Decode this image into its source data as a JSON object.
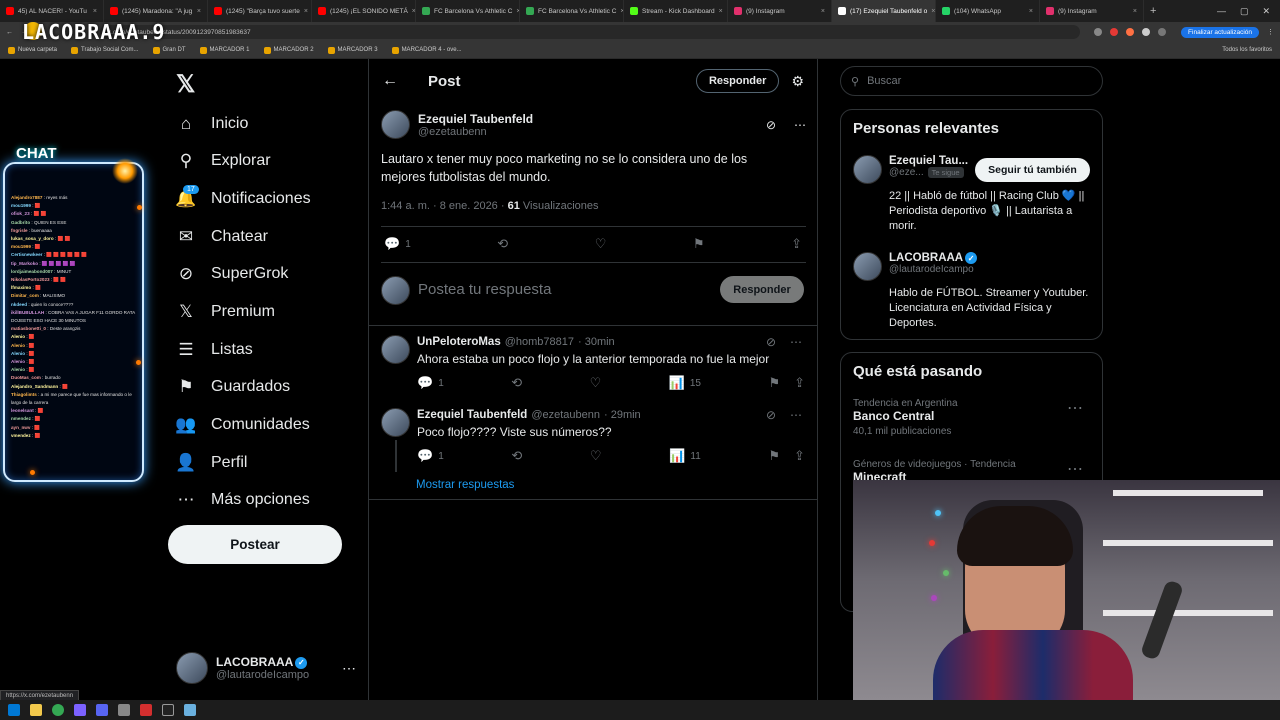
{
  "browser": {
    "tabs": [
      {
        "label": "45) AL NACER! - YouTu",
        "color": "#ff0000"
      },
      {
        "label": "(1245) Maradona: \"A jug",
        "color": "#ff0000"
      },
      {
        "label": "(1245) \"Barça tuvo suerte",
        "color": "#ff0000"
      },
      {
        "label": "(1245) ¡EL SONIDO METÁ",
        "color": "#ff0000"
      },
      {
        "label": "FC Barcelona Vs Athletic C",
        "color": "#34a853"
      },
      {
        "label": "FC Barcelona Vs Athletic C",
        "color": "#34a853"
      },
      {
        "label": "Stream - Kick Dashboard",
        "color": "#53fc18"
      },
      {
        "label": "(9) Instagram",
        "color": "#e1306c"
      },
      {
        "label": "(17) Ezequiel Taubenfeld o",
        "color": "#ffffff"
      },
      {
        "label": "(104) WhatsApp",
        "color": "#25d366"
      },
      {
        "label": "(9) Instagram",
        "color": "#e1306c"
      }
    ],
    "active_tab_index": 8,
    "new_tab": "+",
    "url": "x.com/ezetaubenn/status/2009123970851983637",
    "update_label": "Finalizar actualización",
    "bookmarks": [
      "Nueva carpeta",
      "Trabajo Social Com...",
      "Gran DT",
      "MARCADOR 1",
      "MARCADOR 2",
      "MARCADOR 3",
      "MARCADOR 4 - ove..."
    ],
    "all_bookmarks": "Todos los favoritos",
    "status_url": "https://x.com/ezetaubenn"
  },
  "overlay": {
    "logo_text": "LACOBRAAA.9",
    "chat_title": "CHAT",
    "chat_lines": [
      {
        "user": "Alejandro7887",
        "text": ": reyes más"
      },
      {
        "user": "mou1999",
        "text": ": 🟥"
      },
      {
        "user": "ofiok_23",
        "text": ": 🟥 🟥"
      },
      {
        "user": "Gadbrito",
        "text": ": QUIEN ES ESE"
      },
      {
        "user": "fngrisle",
        "text": ": buenaaaa"
      },
      {
        "user": "lukas_sosa_y_doro",
        "text": ": 🟥 🟥"
      },
      {
        "user": "mou1999",
        "text": ": 🟥"
      },
      {
        "user": "Certisnewkeer",
        "text": ": 🟥 🟥 🟥 🟥 🟥 🟥"
      },
      {
        "user": "tip_Markoko",
        "text": ": 🟪 🟪 🟪 🟪 🟪"
      },
      {
        "user": "lordjaimeabond007",
        "text": ": MINUT"
      },
      {
        "user": "NikolasPorto2023",
        "text": ": 🟥 🟥"
      },
      {
        "user": "lfmaximo",
        "text": ": 🟥"
      },
      {
        "user": "Dimitar_com",
        "text": ": MALISIMO"
      },
      {
        "user": "nkdeed",
        "text": ": quien lo conoce????"
      },
      {
        "user": "ikillBUBULLAH",
        "text": ": COBRA VAS A JUGAR F11 GORDO RATA"
      },
      {
        "user": "",
        "text": "DOJEETE ESO HACE 30 MINUTOS"
      },
      {
        "user": "matiasbonetti_0",
        "text": ": Deste arangzis"
      },
      {
        "user": "Alenio",
        "text": ": 🟥"
      },
      {
        "user": "Alenio",
        "text": ": 🟥"
      },
      {
        "user": "Alenio",
        "text": ": 🟥"
      },
      {
        "user": "Alenio",
        "text": ": 🟥"
      },
      {
        "user": "Alenio",
        "text": ": 🟥"
      },
      {
        "user": "DuoMas_com",
        "text": ": burrado"
      },
      {
        "user": "Alejandro_Sandmann",
        "text": ": 🟥"
      },
      {
        "user": "Thiagolimts",
        "text": ": a mi me parece que fue mas informando o le"
      },
      {
        "user": "",
        "text": "largo de la carrera"
      },
      {
        "user": "leonelsant",
        "text": ": 🟥"
      },
      {
        "user": "nmendez",
        "text": ": 🟥"
      },
      {
        "user": "ayn_nwv",
        "text": ": 🟥"
      },
      {
        "user": "vmendez",
        "text": ": 🟥"
      }
    ]
  },
  "nav": {
    "items": [
      {
        "label": "Inicio",
        "icon": "home-icon",
        "glyph": "⌂"
      },
      {
        "label": "Explorar",
        "icon": "search-icon",
        "glyph": "⚲"
      },
      {
        "label": "Notificaciones",
        "icon": "bell-icon",
        "glyph": "🔔"
      },
      {
        "label": "Chatear",
        "icon": "mail-icon",
        "glyph": "✉"
      },
      {
        "label": "SuperGrok",
        "icon": "grok-icon",
        "glyph": "⊘"
      },
      {
        "label": "Premium",
        "icon": "x-premium-icon",
        "glyph": "𝕏"
      },
      {
        "label": "Listas",
        "icon": "list-icon",
        "glyph": "☰"
      },
      {
        "label": "Guardados",
        "icon": "bookmark-icon",
        "glyph": "⚑"
      },
      {
        "label": "Comunidades",
        "icon": "communities-icon",
        "glyph": "👥"
      },
      {
        "label": "Perfil",
        "icon": "profile-icon",
        "glyph": "👤"
      },
      {
        "label": "Más opciones",
        "icon": "more-icon",
        "glyph": "⋯"
      }
    ],
    "notif_count": "17",
    "post_label": "Postear",
    "account": {
      "name": "LACOBRAAA",
      "handle": "@lautarodeIcampo"
    }
  },
  "post": {
    "header_title": "Post",
    "reply_header": "Responder",
    "author": {
      "name": "Ezequiel Taubenfeld",
      "handle": "@ezetaubenn"
    },
    "text": "Lautaro x tener muy poco marketing no se lo considera uno de los mejores futbolistas del mundo.",
    "time": "1:44 a. m. · 8 ene. 2026 ·",
    "views": "61",
    "views_label": "Visualizaciones",
    "replies": "1",
    "composer_placeholder": "Postea tu respuesta",
    "composer_button": "Responder"
  },
  "replies": [
    {
      "name": "UnPeloteroMas",
      "handle": "@homb78817",
      "time": "· 30min",
      "text": "Ahora estaba un poco flojo y la anterior temporada no fue la mejor",
      "replies": "1",
      "views": "15"
    },
    {
      "name": "Ezequiel Taubenfeld",
      "handle": "@ezetaubenn",
      "time": "· 29min",
      "text": "Poco flojo???? Viste sus números??",
      "replies": "1",
      "views": "11"
    }
  ],
  "show_replies": "Mostrar respuestas",
  "sidebar": {
    "search_placeholder": "Buscar",
    "relevant_title": "Personas relevantes",
    "people": [
      {
        "name": "Ezequiel Tau...",
        "handle": "@eze...",
        "follows_you": "Te sigue",
        "bio": "22 || Habló de fútbol || Racing Club 💙 || Periodista deportivo 🎙️ || Lautarista a morir.",
        "button": "Seguir tú también"
      },
      {
        "name": "LACOBRAAA",
        "handle": "@lautarodeIcampo",
        "bio": "Hablo de FÚTBOL. Streamer y Youtuber. Licenciatura en Actividad Física y Deportes."
      }
    ],
    "trends_title": "Qué está pasando",
    "trends": [
      {
        "category": "Tendencia en Argentina",
        "name": "Banco Central",
        "count": "40,1 mil publicaciones"
      },
      {
        "category": "Géneros de videojuegos · Tendencia",
        "name": "Minecraft",
        "count": ""
      }
    ]
  },
  "colors": {
    "accent": "#1d9bf0",
    "bg": "#000000",
    "border": "#2f3336",
    "muted": "#71767b"
  }
}
